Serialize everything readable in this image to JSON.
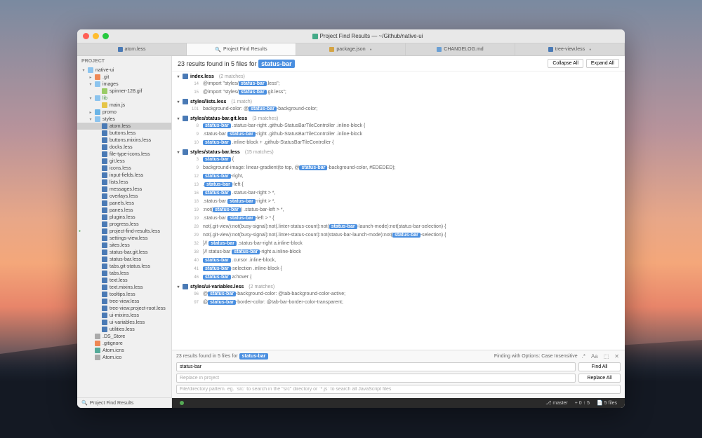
{
  "window": {
    "title": "Project Find Results — ~/Github/native-ui"
  },
  "tabs": [
    {
      "label": "atom.less",
      "type": "less",
      "active": false,
      "modified": false
    },
    {
      "label": "Project Find Results",
      "type": "search",
      "active": true,
      "modified": false,
      "icon": "🔍"
    },
    {
      "label": "package.json",
      "type": "json",
      "active": false,
      "modified": true
    },
    {
      "label": "CHANGELOG.md",
      "type": "md",
      "active": false,
      "modified": false
    },
    {
      "label": "tree-view.less",
      "type": "less",
      "active": false,
      "modified": true
    }
  ],
  "sidebar": {
    "header": "PROJECT",
    "footer": "Project Find Results",
    "tree": [
      {
        "depth": 0,
        "icon": "folderopen",
        "label": "native-ui",
        "arrow": "▾"
      },
      {
        "depth": 1,
        "icon": "git",
        "label": ".git",
        "arrow": "▸"
      },
      {
        "depth": 1,
        "icon": "folderopen",
        "label": "images",
        "arrow": "▾"
      },
      {
        "depth": 2,
        "icon": "gif",
        "label": "spinner-128.gif"
      },
      {
        "depth": 1,
        "icon": "folderopen",
        "label": "lib",
        "arrow": "▾",
        "green": true
      },
      {
        "depth": 2,
        "icon": "js",
        "label": "main.js"
      },
      {
        "depth": 1,
        "icon": "folder",
        "label": "promo",
        "arrow": "▸"
      },
      {
        "depth": 1,
        "icon": "folderopen",
        "label": "styles",
        "arrow": "▾"
      },
      {
        "depth": 2,
        "icon": "less",
        "label": "atom.less",
        "sel": true
      },
      {
        "depth": 2,
        "icon": "less",
        "label": "buttons.less"
      },
      {
        "depth": 2,
        "icon": "less",
        "label": "buttons.mixins.less"
      },
      {
        "depth": 2,
        "icon": "less",
        "label": "docks.less"
      },
      {
        "depth": 2,
        "icon": "less",
        "label": "file-type-icons.less"
      },
      {
        "depth": 2,
        "icon": "less",
        "label": "git.less"
      },
      {
        "depth": 2,
        "icon": "less",
        "label": "icons.less"
      },
      {
        "depth": 2,
        "icon": "less",
        "label": "input-fields.less"
      },
      {
        "depth": 2,
        "icon": "less",
        "label": "lists.less"
      },
      {
        "depth": 2,
        "icon": "less",
        "label": "messages.less"
      },
      {
        "depth": 2,
        "icon": "less",
        "label": "overlays.less"
      },
      {
        "depth": 2,
        "icon": "less",
        "label": "panels.less"
      },
      {
        "depth": 2,
        "icon": "less",
        "label": "panes.less"
      },
      {
        "depth": 2,
        "icon": "less",
        "label": "plugins.less"
      },
      {
        "depth": 2,
        "icon": "less",
        "label": "progress.less"
      },
      {
        "depth": 2,
        "icon": "less",
        "label": "project-find-results.less",
        "status": true
      },
      {
        "depth": 2,
        "icon": "less",
        "label": "settings-view.less"
      },
      {
        "depth": 2,
        "icon": "less",
        "label": "sites.less"
      },
      {
        "depth": 2,
        "icon": "less",
        "label": "status-bar.git.less"
      },
      {
        "depth": 2,
        "icon": "less",
        "label": "status-bar.less"
      },
      {
        "depth": 2,
        "icon": "less",
        "label": "tabs.git-status.less"
      },
      {
        "depth": 2,
        "icon": "less",
        "label": "tabs.less"
      },
      {
        "depth": 2,
        "icon": "less",
        "label": "text.less"
      },
      {
        "depth": 2,
        "icon": "less",
        "label": "text.mixins.less"
      },
      {
        "depth": 2,
        "icon": "less",
        "label": "tooltips.less"
      },
      {
        "depth": 2,
        "icon": "less",
        "label": "tree-view.less"
      },
      {
        "depth": 2,
        "icon": "less",
        "label": "tree-view.project-root.less"
      },
      {
        "depth": 2,
        "icon": "less",
        "label": "ui-mixins.less"
      },
      {
        "depth": 2,
        "icon": "less",
        "label": "ui-variables.less"
      },
      {
        "depth": 2,
        "icon": "less",
        "label": "utilities.less"
      },
      {
        "depth": 1,
        "icon": "file",
        "label": ".DS_Store"
      },
      {
        "depth": 1,
        "icon": "git",
        "label": ".gitignore"
      },
      {
        "depth": 1,
        "icon": "atom",
        "label": "Atom.icns"
      },
      {
        "depth": 1,
        "icon": "file",
        "label": "Atom.ico"
      }
    ]
  },
  "results": {
    "summary_prefix": "23 results found in 5 files for",
    "query": "status-bar",
    "collapse_label": "Collapse All",
    "expand_label": "Expand All",
    "files": [
      {
        "path": "index.less",
        "count": "(2 matches)",
        "lines": [
          {
            "n": 14,
            "pre": "@import \"styles/",
            "post": ".less\";"
          },
          {
            "n": 15,
            "pre": "@import \"styles/",
            "post": ".git.less\";"
          }
        ]
      },
      {
        "path": "styles/lists.less",
        "count": "(1 match)",
        "lines": [
          {
            "n": 101,
            "pre": "background-color: @",
            "post": "-background-color;"
          }
        ]
      },
      {
        "path": "styles/status-bar.git.less",
        "count": "(3 matches)",
        "lines": [
          {
            "n": 8,
            "pre": "",
            "post": " .status-bar-right .github-StatusBarTileController .inline-block {"
          },
          {
            "n": 9,
            "pre": ".status-bar ",
            "post": "-right .github-StatusBarTileController .inline-block"
          },
          {
            "n": 10,
            "pre": "",
            "post": " .inline-block + .github-StatusBarTileController {"
          }
        ]
      },
      {
        "path": "styles/status-bar.less",
        "count": "(15 matches)",
        "lines": [
          {
            "n": 3,
            "pre": "",
            "post": " {"
          },
          {
            "n": 9,
            "pre": "background-image: linear-gradient(to top, @",
            "post": "-background-color, #EDEDED);"
          },
          {
            "n": 12,
            "pre": "",
            "post": "-right,"
          },
          {
            "n": 13,
            "pre": ".",
            "post": "-left {"
          },
          {
            "n": 16,
            "pre": "",
            "post": " .status-bar-right > *,"
          },
          {
            "n": 18,
            "pre": ".status-bar ",
            "post": "-right > *,"
          },
          {
            "n": 19,
            "pre": ":not(",
            "post": ") .status-bar-left > *,"
          },
          {
            "n": 19,
            "pre": ".status-bar ",
            "post": "-left > * {"
          },
          {
            "n": 28,
            "pre": "not(.git-view):not(busy-signal):not(.linter-status-count):not(",
            "post": "-launch-mode):not(status-bar-selection) {"
          },
          {
            "n": 29,
            "pre": "not(.git-view):not(busy-signal):not(.linter-status-count):not(status-bar-launch-mode):not(",
            "post": "-selection) {"
          },
          {
            "n": 32,
            "pre": "}// ",
            "post": " .status-bar-right a.inline-block"
          },
          {
            "n": 38,
            "pre": "}// status-bar ",
            "post": "-right a.inline-block"
          },
          {
            "n": 40,
            "pre": "",
            "post": " .cursor .inline-block,"
          },
          {
            "n": 41,
            "pre": "",
            "post": "-selection .inline-block {"
          },
          {
            "n": 46,
            "pre": "",
            "post": " a:hover {"
          }
        ]
      },
      {
        "path": "styles/ui-variables.less",
        "count": "(2 matches)",
        "lines": [
          {
            "n": 96,
            "pre": "@",
            "post": "-background-color: @tab-background-color-active;"
          },
          {
            "n": 97,
            "pre": "@",
            "post": "-border-color: @tab-bar-border-color-transparent;"
          }
        ]
      }
    ]
  },
  "find": {
    "status_prefix": "23 results found in 5 files for",
    "options_label": "Finding with Options: Case Insensitive",
    "search_value": "status-bar",
    "replace_placeholder": "Replace in project",
    "path_placeholder": "File/directory pattern. eg. `src` to search in the \"src\" directory or `*.js` to search all JavaScript files",
    "find_btn": "Find All",
    "replace_btn": "Replace All"
  },
  "status": {
    "branch": "master",
    "diff": "+ 0 ↑ 5",
    "files": "5 files"
  }
}
